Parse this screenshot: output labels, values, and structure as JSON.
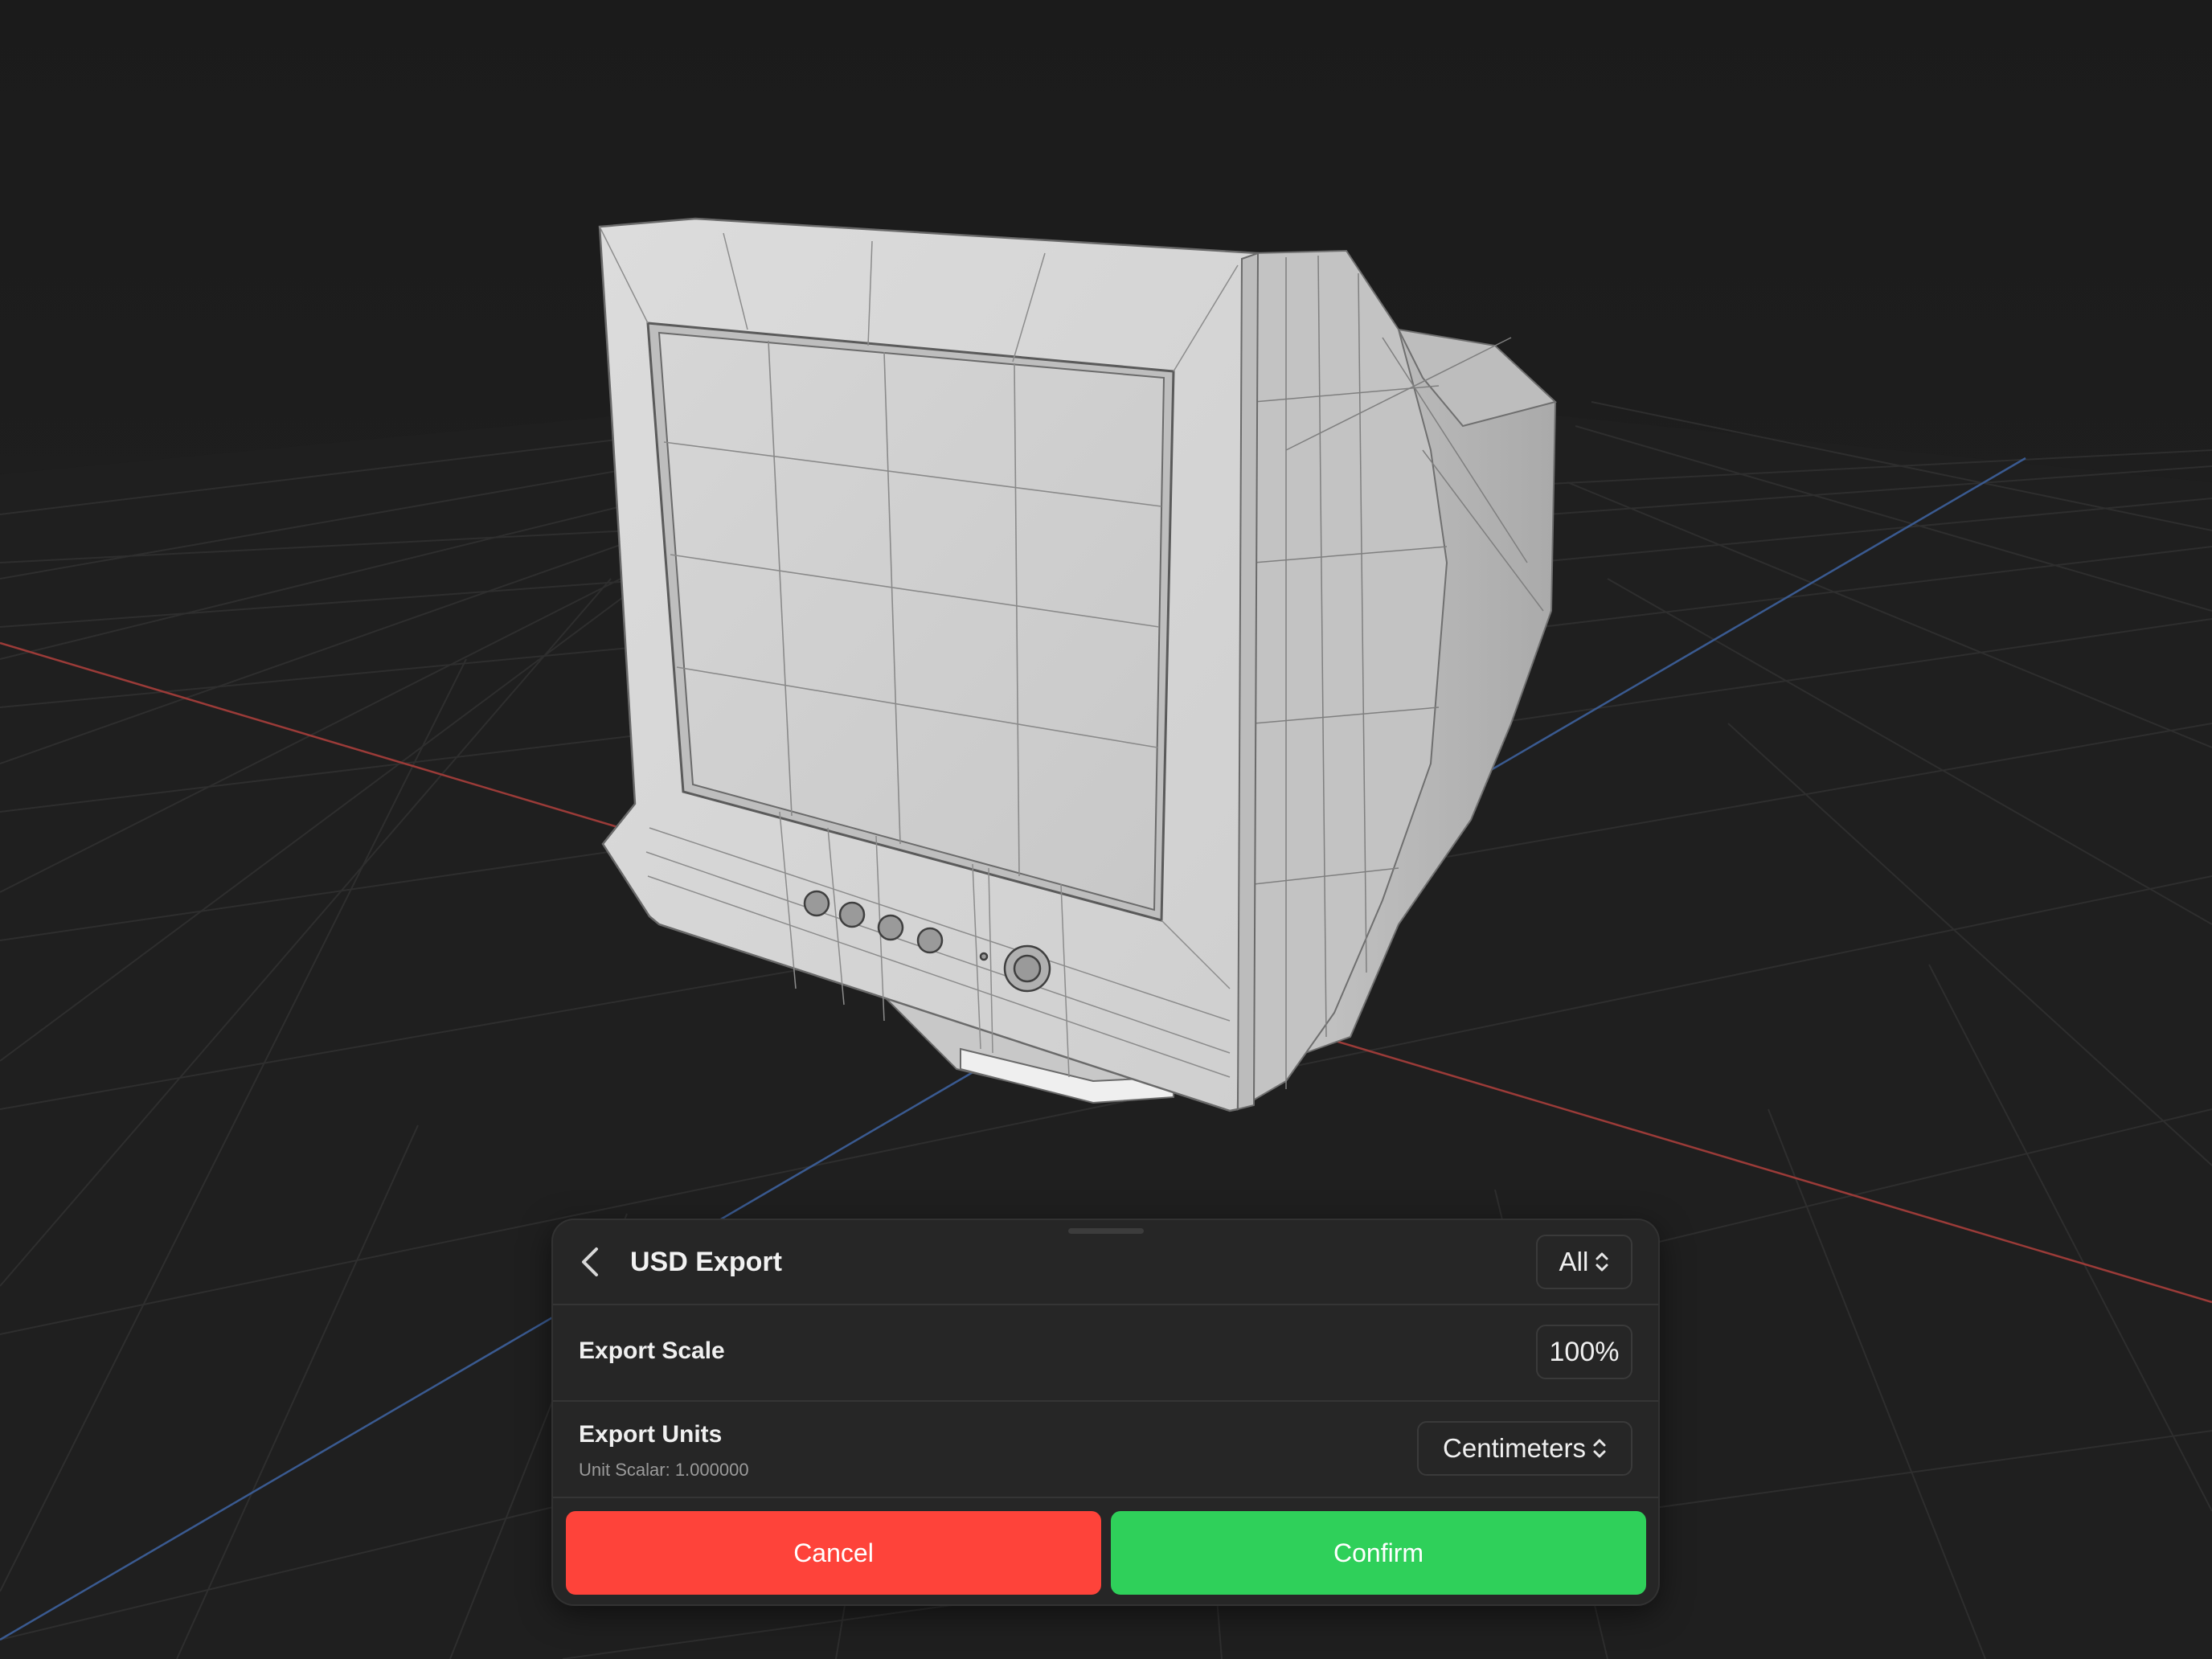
{
  "viewport": {
    "object": "crt-monitor-wireframe-model",
    "background": "#1c1c1c",
    "axis_colors": {
      "x": "#9b3b38",
      "z": "#3a5a90"
    }
  },
  "export_sheet": {
    "title": "USD Export",
    "back_icon": "chevron-left-icon",
    "filter": {
      "value": "All",
      "icon": "up-down-chevron-icon"
    },
    "export_scale": {
      "label": "Export Scale",
      "value": "100%"
    },
    "export_units": {
      "label": "Export Units",
      "subtitle": "Unit Scalar: 1.000000",
      "value": "Centimeters",
      "icon": "up-down-chevron-icon"
    },
    "actions": {
      "cancel_label": "Cancel",
      "confirm_label": "Confirm",
      "cancel_color": "#fe433a",
      "confirm_color": "#2fd05a"
    }
  }
}
